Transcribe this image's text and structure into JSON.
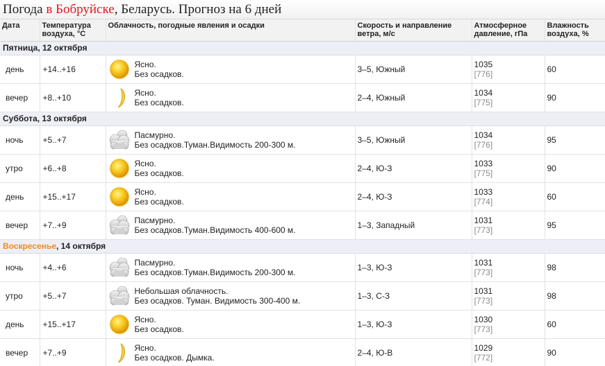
{
  "header": {
    "prefix": "Погода ",
    "city": "в Бобруйске",
    "suffix": ", Беларусь. Прогноз на 6 дней"
  },
  "columns": {
    "date": "Дата",
    "temp": "Температура воздуха, °C",
    "cloud": "Облачность, погодные явления и осадки",
    "wind": "Скорость и направление ветра, м/с",
    "pressure": "Атмосферное давление, гПа",
    "humidity": "Влажность воздуха, %"
  },
  "days": [
    {
      "weekday": "Пятница",
      "date": ", 12 октября",
      "weekend": false,
      "rows": [
        {
          "period": "день",
          "temp": "+14..+16",
          "icon": "sun-icon",
          "line1": "Ясно.",
          "line2": "Без осадков.",
          "wind": "3–5, Южный",
          "pressure": "1035",
          "pressure_sub": "[776]",
          "humidity": "60"
        },
        {
          "period": "вечер",
          "temp": "+8..+10",
          "icon": "moon-icon",
          "line1": "Ясно.",
          "line2": "Без осадков.",
          "wind": "2–4, Южный",
          "pressure": "1034",
          "pressure_sub": "[775]",
          "humidity": "90"
        }
      ]
    },
    {
      "weekday": "Суббота",
      "date": ", 13 октября",
      "weekend": false,
      "rows": [
        {
          "period": "ночь",
          "temp": "+5..+7",
          "icon": "fog-cloud-icon",
          "line1": "Пасмурно.",
          "line2": "Без осадков.Туман.Видимость 200-300 м.",
          "wind": "3–5, Южный",
          "pressure": "1034",
          "pressure_sub": "[776]",
          "humidity": "95"
        },
        {
          "period": "утро",
          "temp": "+6..+8",
          "icon": "sun-icon",
          "line1": "Ясно.",
          "line2": "Без осадков.",
          "wind": "2–4, Ю-З",
          "pressure": "1033",
          "pressure_sub": "[775]",
          "humidity": "90"
        },
        {
          "period": "день",
          "temp": "+15..+17",
          "icon": "sun-icon",
          "line1": "Ясно.",
          "line2": "Без осадков.",
          "wind": "2–4, Ю-З",
          "pressure": "1033",
          "pressure_sub": "[774]",
          "humidity": "60"
        },
        {
          "period": "вечер",
          "temp": "+7..+9",
          "icon": "fog-cloud-icon",
          "line1": "Пасмурно.",
          "line2": "Без осадков.Туман.Видимость 400-600 м.",
          "wind": "1–3, Западный",
          "pressure": "1031",
          "pressure_sub": "[773]",
          "humidity": "95"
        }
      ]
    },
    {
      "weekday": "Воскресенье",
      "date": ", 14 октября",
      "weekend": true,
      "rows": [
        {
          "period": "ночь",
          "temp": "+4..+6",
          "icon": "fog-cloud-icon",
          "line1": "Пасмурно.",
          "line2": "Без осадков.Туман.Видимость 200-300 м.",
          "wind": "1–3, Ю-З",
          "pressure": "1031",
          "pressure_sub": "[773]",
          "humidity": "98"
        },
        {
          "period": "утро",
          "temp": "+5..+7",
          "icon": "fog-cloud-icon",
          "line1": "Небольшая облачность.",
          "line2": "Без осадков. Туман. Видимость 300-400 м.",
          "wind": "1–3, С-З",
          "pressure": "1031",
          "pressure_sub": "[773]",
          "humidity": "98"
        },
        {
          "period": "день",
          "temp": "+15..+17",
          "icon": "sun-icon",
          "line1": "Ясно.",
          "line2": "Без осадков.",
          "wind": "1–3, Ю-З",
          "pressure": "1030",
          "pressure_sub": "[773]",
          "humidity": "60"
        },
        {
          "period": "вечер",
          "temp": "+7..+9",
          "icon": "moon-icon",
          "line1": "Ясно.",
          "line2": "Без осадков. Дымка.",
          "wind": "2–4, Ю-В",
          "pressure": "1029",
          "pressure_sub": "[772]",
          "humidity": "90"
        }
      ]
    }
  ]
}
